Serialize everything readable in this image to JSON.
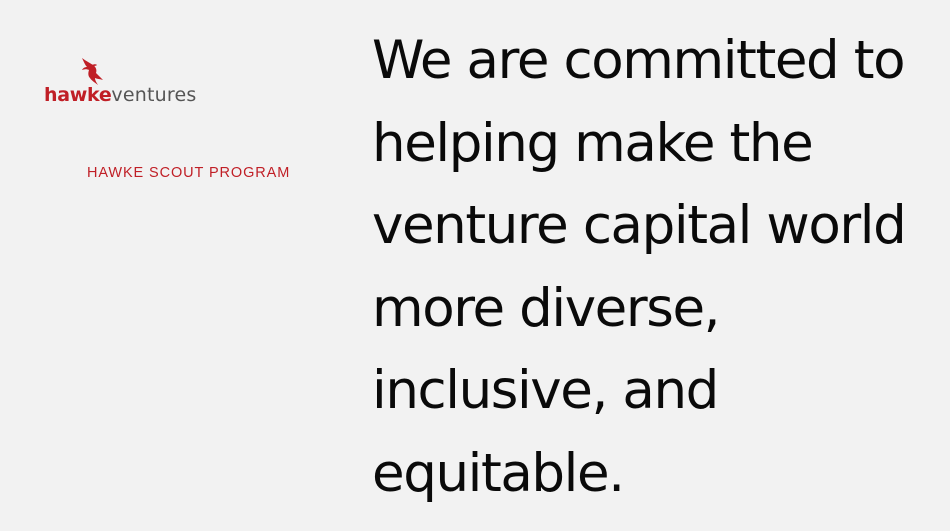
{
  "logo": {
    "icon": "hawk-icon",
    "brand_name_primary": "hawke",
    "brand_name_secondary": "ventures",
    "brand_color": "#c01f26"
  },
  "program_title": "HAWKE SCOUT PROGRAM",
  "statement": "We are committed to helping make the venture capital world more diverse, inclusive, and equitable.",
  "colors": {
    "background": "#f2f2f2",
    "accent": "#c01f26",
    "text": "#0a0a0a",
    "secondary_text": "#555555"
  }
}
